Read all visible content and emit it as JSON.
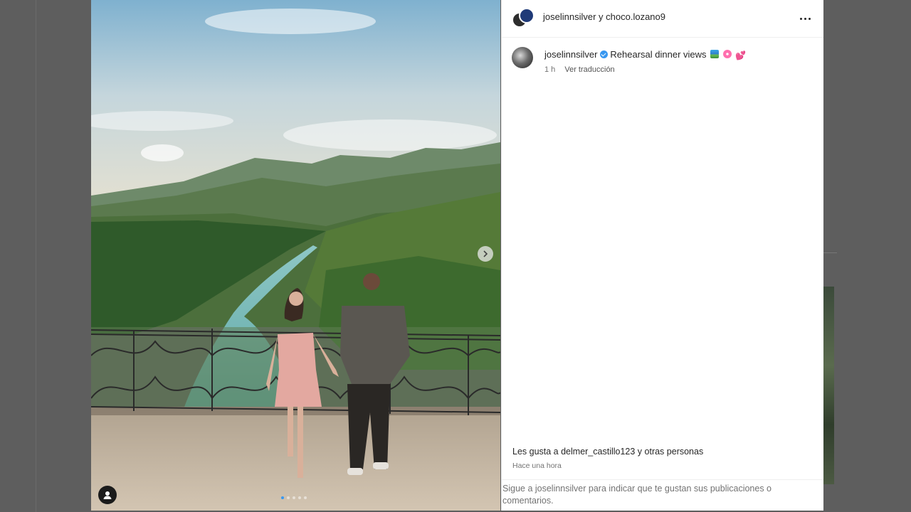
{
  "header": {
    "title": "joselinnsilver y choco.lozano9",
    "more_icon": "more-horizontal-icon"
  },
  "caption": {
    "username": "joselinnsilver",
    "text": "Rehearsal dinner views",
    "emojis": [
      "landscape-emoji",
      "flower-emoji",
      "hearts-emoji"
    ],
    "hearts_glyph": "💕",
    "age": "1 h",
    "translate_label": "Ver traducción"
  },
  "likes": {
    "text": "Les gusta a delmer_castillo123 y otras personas"
  },
  "timestamp": "Hace una hora",
  "footer": {
    "prompt": "Sigue a joselinnsilver para indicar que te gustan sus publicaciones o comentarios."
  },
  "carousel": {
    "total_slides": 5,
    "active_slide": 1
  },
  "colors": {
    "accent": "#3897f0",
    "text": "#262626",
    "muted": "#737373",
    "backdrop": "#5e5e5e"
  }
}
